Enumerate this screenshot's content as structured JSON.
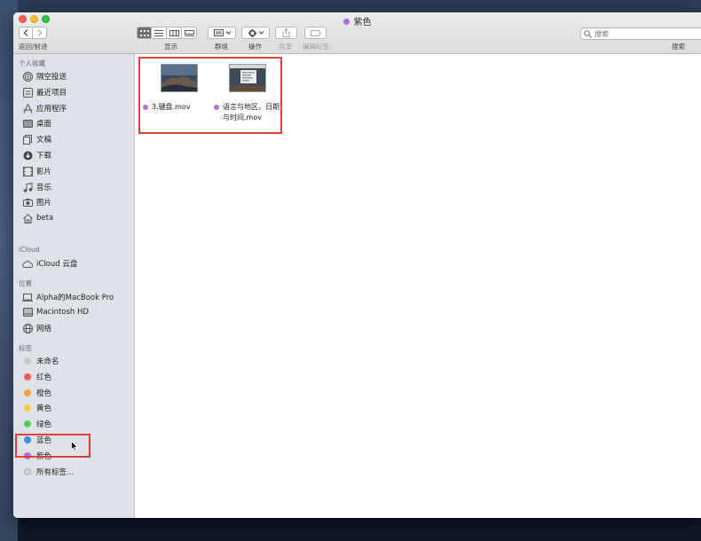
{
  "window": {
    "title": "紫色",
    "title_color": "#b36ae2"
  },
  "toolbar": {
    "nav_label": "返回/前进",
    "view_label": "显示",
    "group_label": "群组",
    "action_label": "操作",
    "share_label": "共享",
    "edit_tags_label": "编辑标签",
    "search_label": "搜索",
    "search_placeholder": "搜索"
  },
  "sidebar": {
    "favorites_header": "个人收藏",
    "favorites": [
      {
        "label": "隔空投送",
        "icon": "airdrop-icon"
      },
      {
        "label": "最近项目",
        "icon": "recents-icon"
      },
      {
        "label": "应用程序",
        "icon": "applications-icon"
      },
      {
        "label": "桌面",
        "icon": "desktop-icon"
      },
      {
        "label": "文稿",
        "icon": "documents-icon"
      },
      {
        "label": "下载",
        "icon": "downloads-icon"
      },
      {
        "label": "影片",
        "icon": "movies-icon"
      },
      {
        "label": "音乐",
        "icon": "music-icon"
      },
      {
        "label": "图片",
        "icon": "pictures-icon"
      },
      {
        "label": "beta",
        "icon": "home-icon"
      }
    ],
    "icloud_header": "iCloud",
    "icloud": [
      {
        "label": "iCloud 云盘",
        "icon": "cloud-icon"
      }
    ],
    "locations_header": "位置",
    "locations": [
      {
        "label": "Alpha的MacBook Pro",
        "icon": "laptop-icon"
      },
      {
        "label": "Macintosh HD",
        "icon": "disk-icon"
      },
      {
        "label": "网络",
        "icon": "network-icon"
      }
    ],
    "tags_header": "标签",
    "tags": [
      {
        "label": "未命名",
        "color": "#c9c9c9"
      },
      {
        "label": "红色",
        "color": "#f05d57"
      },
      {
        "label": "橙色",
        "color": "#f6a23a"
      },
      {
        "label": "黄色",
        "color": "#f5d13a"
      },
      {
        "label": "绿色",
        "color": "#5fc95a"
      },
      {
        "label": "蓝色",
        "color": "#3d8cf0"
      },
      {
        "label": "紫色",
        "color": "#b36ae2"
      },
      {
        "label": "所有标签...",
        "color": "#d6d6d6"
      }
    ]
  },
  "files": [
    {
      "name": "3.键盘.mov",
      "tag_color": "#b36ae2"
    },
    {
      "name": "语言与地区，日期与时间.mov",
      "tag_color": "#b36ae2"
    }
  ]
}
